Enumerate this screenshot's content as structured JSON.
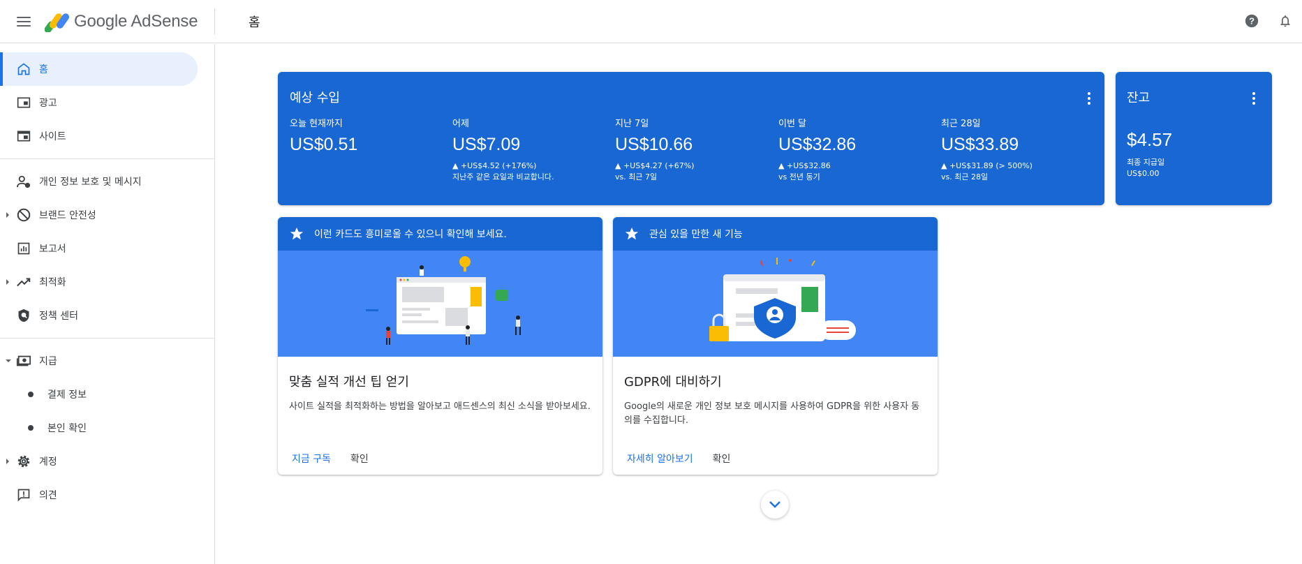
{
  "header": {
    "app_name": "Google AdSense",
    "page_title": "홈",
    "icons": [
      "menu-icon",
      "help-icon",
      "notifications-icon"
    ]
  },
  "sidebar": {
    "items": [
      {
        "label": "홈",
        "icon": "home-icon",
        "active": true
      },
      {
        "label": "광고",
        "icon": "ads-icon"
      },
      {
        "label": "사이트",
        "icon": "sites-icon"
      },
      {
        "label": "개인 정보 보호 및 메시지",
        "icon": "privacy-icon"
      },
      {
        "label": "브랜드 안전성",
        "icon": "block-icon",
        "expandable": true
      },
      {
        "label": "보고서",
        "icon": "reports-icon"
      },
      {
        "label": "최적화",
        "icon": "trending-icon",
        "expandable": true
      },
      {
        "label": "정책 센터",
        "icon": "shield-icon"
      },
      {
        "label": "지급",
        "icon": "payments-icon",
        "expanded": true
      },
      {
        "label": "결제 정보"
      },
      {
        "label": "본인 확인"
      },
      {
        "label": "계정",
        "icon": "gear-icon",
        "expandable": true
      },
      {
        "label": "의견",
        "icon": "feedback-icon"
      }
    ]
  },
  "earnings": {
    "title": "예상 수입",
    "metrics": [
      {
        "label": "오늘 현재까지",
        "value": "US$0.51",
        "delta": "",
        "compare": ""
      },
      {
        "label": "어제",
        "value": "US$7.09",
        "delta": "▲ +US$4.52 (+176%)",
        "compare": "지난주 같은 요일과 비교합니다."
      },
      {
        "label": "지난 7일",
        "value": "US$10.66",
        "delta": "▲ +US$4.27 (+67%)",
        "compare": "vs. 최근 7일"
      },
      {
        "label": "이번 달",
        "value": "US$32.86",
        "delta": "▲ +US$32.86",
        "compare": "vs 전년 동기"
      },
      {
        "label": "최근 28일",
        "value": "US$33.89",
        "delta": "▲ +US$31.89 (> 500%)",
        "compare": "vs. 최근 28일"
      }
    ]
  },
  "balance": {
    "title": "잔고",
    "value": "$4.57",
    "last_payment_label": "최종 지급일",
    "last_payment_value": "US$0.00"
  },
  "promo_cards": [
    {
      "header": "이런 카드도 흥미로울 수 있으니 확인해 보세요.",
      "title": "맞춤 실적 개선 팁 얻기",
      "text": "사이트 실적을 최적화하는 방법을 알아보고 애드센스의 최신 소식을 받아보세요.",
      "primary_action": "지금 구독",
      "secondary_action": "확인"
    },
    {
      "header": "관심 있을 만한 새 기능",
      "title": "GDPR에 대비하기",
      "text": "Google의 새로운 개인 정보 보호 메시지를 사용하여 GDPR을 위한 사용자 동의를 수집합니다.",
      "primary_action": "자세히 알아보기",
      "secondary_action": "확인"
    }
  ],
  "colors": {
    "accent": "#1a73e8",
    "card_blue": "#1967d2",
    "illustration_blue": "#4285f4"
  }
}
